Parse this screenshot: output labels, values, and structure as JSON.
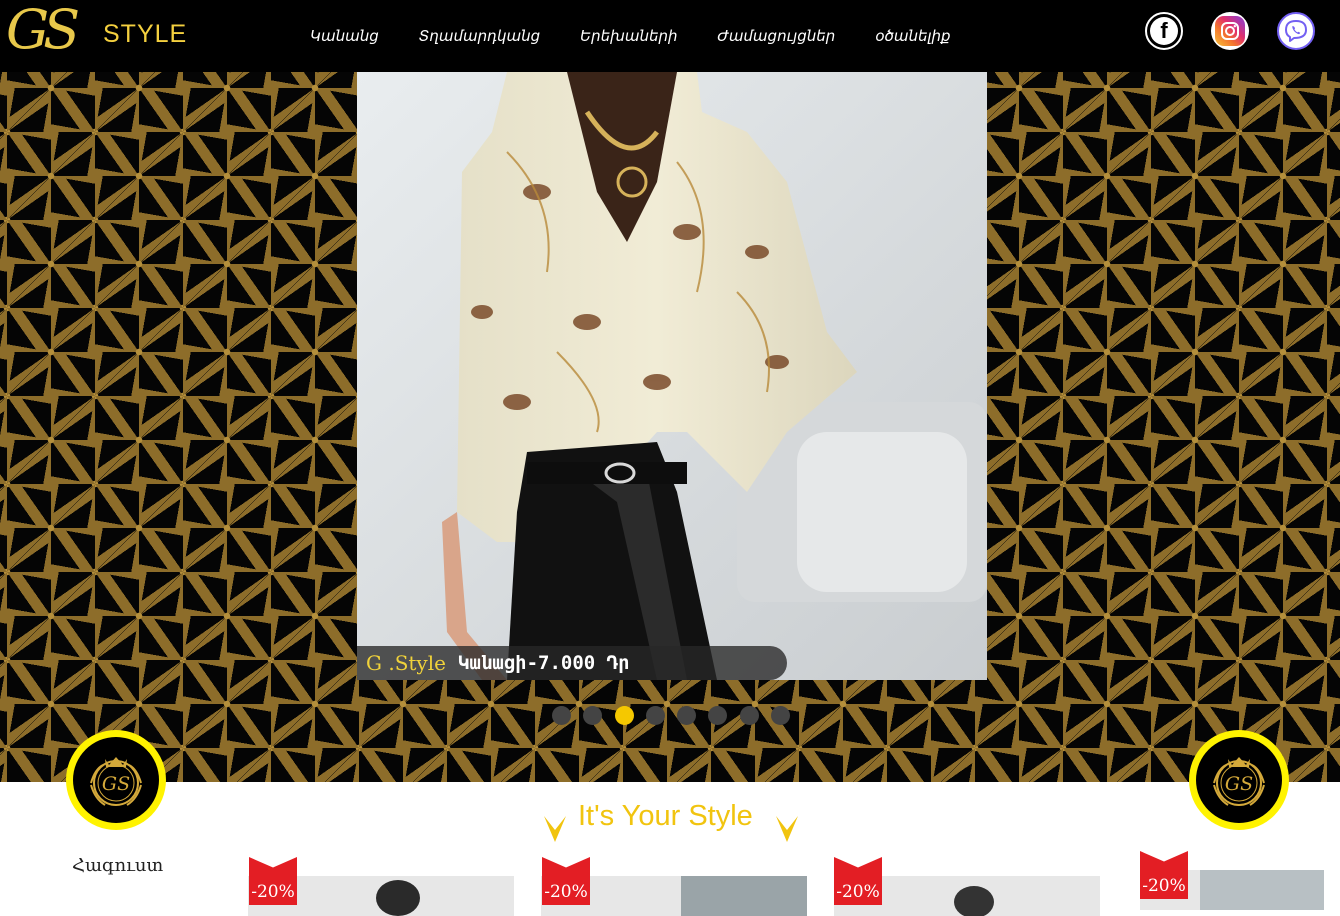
{
  "header": {
    "logo_gs": "GS",
    "logo_style": "STYLE",
    "nav": [
      "Կանանց",
      "Տղամարդկանց",
      "Երեխաների",
      "Ժամացույցներ",
      "օծանելիք"
    ],
    "social": [
      "facebook-icon",
      "instagram-icon",
      "viber-icon"
    ]
  },
  "hero": {
    "caption_brand": "G .Style",
    "caption_text": "Կանացի-7.000 Դր",
    "slide_count": 8,
    "active_slide": 3
  },
  "emblem": {
    "text": "GS"
  },
  "section": {
    "tagline": "It's Your Style",
    "sidebar_link": "Հագուստ"
  },
  "products": [
    {
      "badge": "-20%"
    },
    {
      "badge": "-20%"
    },
    {
      "badge": "-20%"
    },
    {
      "badge": "-20%"
    }
  ],
  "colors": {
    "accent": "#f5c800",
    "sale_badge": "#e31e24",
    "header_bg": "#000000"
  }
}
